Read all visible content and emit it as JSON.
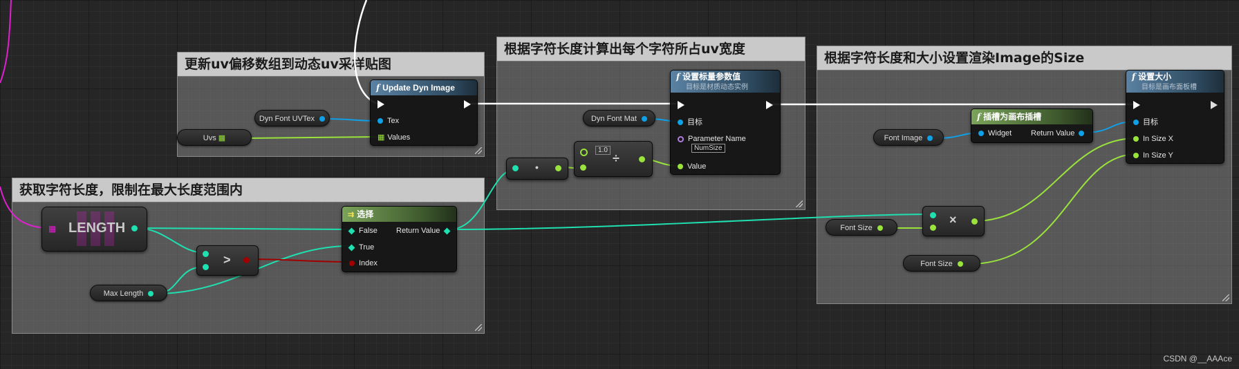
{
  "comments": {
    "update": "更新uv偏移数组到动态uv采样贴图",
    "calc": "根据字符长度计算出每个字符所占uv宽度",
    "size": "根据字符长度和大小设置渲染Image的Size",
    "length": "获取字符长度，限制在最大长度范围内"
  },
  "update_node": {
    "title": "Update Dyn Image",
    "pin_tex": "Tex",
    "pin_values": "Values"
  },
  "vars": {
    "dyn_font_uvtex": "Dyn Font UVTex",
    "uvs": "Uvs",
    "dyn_font_mat": "Dyn Font Mat",
    "font_image": "Font Image",
    "font_size_1": "Font Size",
    "font_size_2": "Font Size",
    "max_length": "Max Length"
  },
  "scalar_node": {
    "title": "设置标量参数值",
    "subtitle": "目标是材质动态实例",
    "pin_target": "目标",
    "pin_param": "Parameter Name",
    "param_value": "NumSize",
    "pin_value": "Value"
  },
  "divide_node": {
    "literal": "1.0"
  },
  "multiply_small": {
    "symbol": "•"
  },
  "slot_node": {
    "title": "插槽为画布插槽",
    "pin_widget": "Widget",
    "pin_return": "Return Value"
  },
  "setsize_node": {
    "title": "设置大小",
    "subtitle": "目标是画布面板槽",
    "pin_target": "目标",
    "pin_x": "In Size X",
    "pin_y": "In Size Y"
  },
  "multiply_node": {
    "symbol": "×"
  },
  "length_node": {
    "label": "LENGTH"
  },
  "greater_node": {
    "symbol": ">"
  },
  "select_node": {
    "title": "选择",
    "pin_false": "False",
    "pin_true": "True",
    "pin_index": "Index",
    "pin_return": "Return Value"
  },
  "watermark": "CSDN @__AAAce",
  "colors": {
    "exec": "#ffffff",
    "object": "#0fa0e6",
    "float": "#9ae23c",
    "int": "#1fe0b0",
    "bool": "#a00000",
    "name": "#b07ee0",
    "string_array": "#e020d0"
  }
}
